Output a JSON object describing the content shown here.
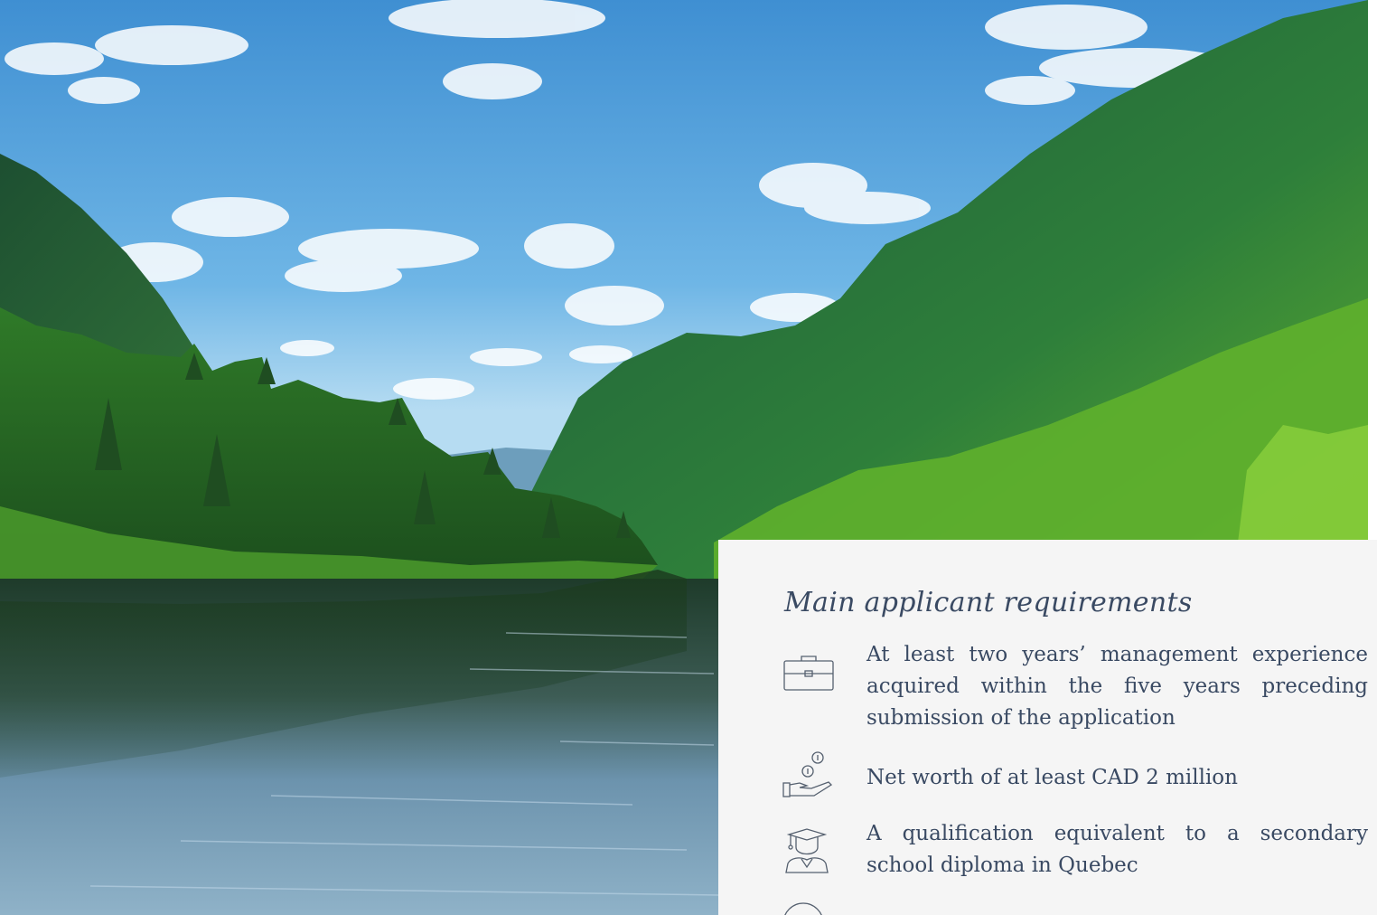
{
  "hero": {
    "description_alt": "",
    "colors": {
      "sky_top": "#3f93d6",
      "sky_bottom": "#b9def2",
      "forest_dark": "#1f4f2c",
      "forest_mid": "#2f7a2f",
      "forest_light": "#66b83a",
      "water": "#2d4a5c"
    }
  },
  "requirements_panel": {
    "title": "Main applicant requirements",
    "items": [
      {
        "icon": "briefcase-icon",
        "text": "At least two years’ management experience acquired within the five years preceding submission of the application"
      },
      {
        "icon": "hand-coins-icon",
        "text": "Net worth of at least CAD 2 million"
      },
      {
        "icon": "graduate-icon",
        "text": "A qualification equivalent to a secondary school diploma in Quebec"
      },
      {
        "icon": "circle-icon",
        "text": ""
      }
    ],
    "colors": {
      "background": "#f5f5f5",
      "text": "#3a4a63"
    }
  }
}
